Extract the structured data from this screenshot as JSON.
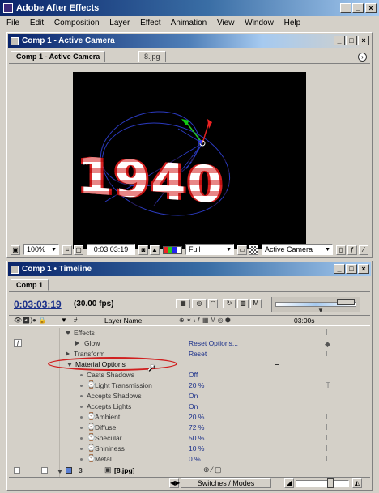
{
  "app": {
    "title": "Adobe After Effects",
    "menu": [
      "File",
      "Edit",
      "Composition",
      "Layer",
      "Effect",
      "Animation",
      "View",
      "Window",
      "Help"
    ]
  },
  "comp_window": {
    "title": "Comp 1 - Active Camera",
    "tabs": [
      "Comp 1 - Active Camera",
      "8.jpg"
    ],
    "text_art": "1940",
    "footer": {
      "zoom": "100%",
      "timecode": "0:03:03:19",
      "resolution": "Full",
      "view": "Active Camera"
    }
  },
  "timeline_window": {
    "title": "Comp 1 • Timeline",
    "tab": "Comp 1",
    "timecode": "0:03:03:19",
    "fps": "(30.00 fps)",
    "ruler_label": "03:00s",
    "column_header": "Layer Name",
    "footer_label": "Switches / Modes",
    "rows": [
      {
        "label": "Effects",
        "value": ""
      },
      {
        "label": "Glow",
        "value": "Reset  Options..."
      },
      {
        "label": "Transform",
        "value": "Reset"
      },
      {
        "label": "Material Options",
        "value": ""
      },
      {
        "label": "Casts Shadows",
        "value": "Off"
      },
      {
        "label": "Light Transmission",
        "value": "20 %"
      },
      {
        "label": "Accepts Shadows",
        "value": "On"
      },
      {
        "label": "Accepts Lights",
        "value": "On"
      },
      {
        "label": "Ambient",
        "value": "20 %"
      },
      {
        "label": "Diffuse",
        "value": "72 %"
      },
      {
        "label": "Specular",
        "value": "50 %"
      },
      {
        "label": "Shininess",
        "value": "10 %"
      },
      {
        "label": "Metal",
        "value": "0 %"
      }
    ],
    "layer3": {
      "index": "3",
      "name": "[8.jpg]"
    }
  },
  "colors": {
    "title_active": "#0a246a",
    "highlight_ellipse": "#d02020",
    "value_text": "#1a2f8a",
    "canvas": "#000000"
  }
}
